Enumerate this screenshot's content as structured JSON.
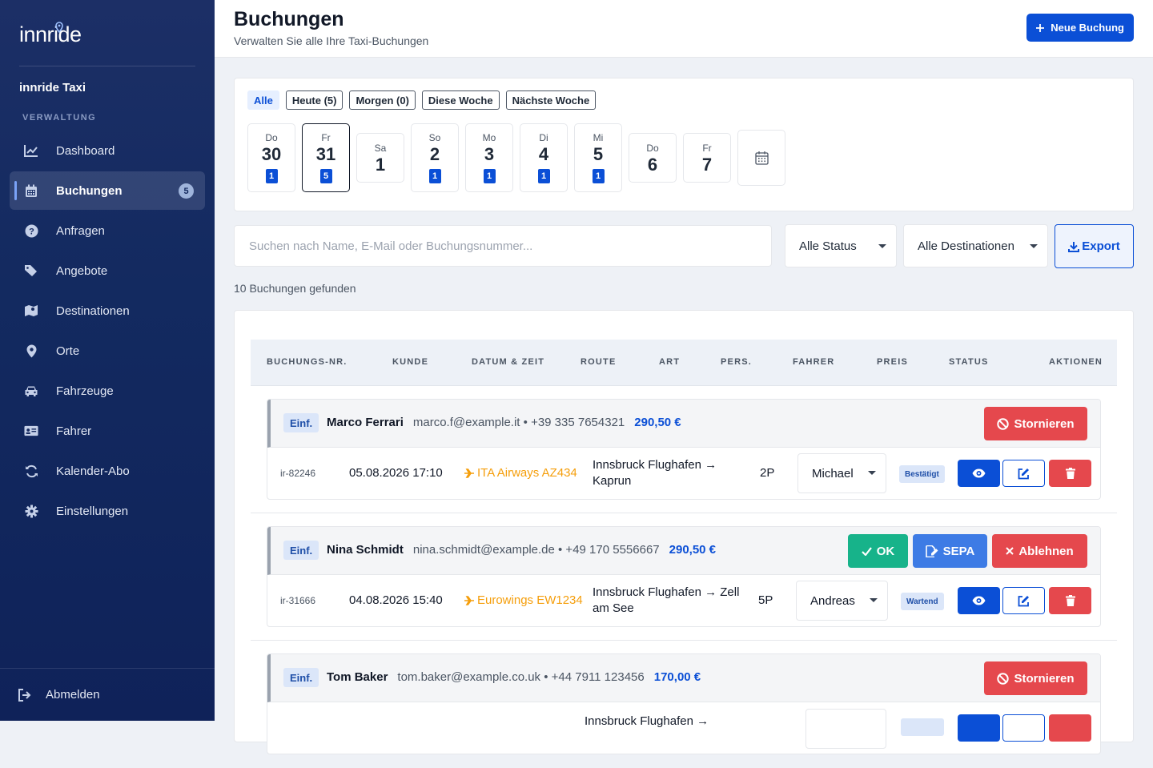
{
  "sidebar": {
    "logo": "innride",
    "brand": "innride Taxi",
    "section": "VERWALTUNG",
    "items": [
      {
        "label": "Dashboard",
        "icon": "chart-line-icon"
      },
      {
        "label": "Buchungen",
        "icon": "calendar-icon",
        "badge": "5",
        "active": true
      },
      {
        "label": "Anfragen",
        "icon": "question-circle-icon"
      },
      {
        "label": "Angebote",
        "icon": "tags-icon"
      },
      {
        "label": "Destinationen",
        "icon": "map-icon"
      },
      {
        "label": "Orte",
        "icon": "map-pin-icon"
      },
      {
        "label": "Fahrzeuge",
        "icon": "car-icon"
      },
      {
        "label": "Fahrer",
        "icon": "id-card-icon"
      },
      {
        "label": "Kalender-Abo",
        "icon": "sync-icon"
      },
      {
        "label": "Einstellungen",
        "icon": "gear-icon"
      }
    ],
    "logout": "Abmelden"
  },
  "header": {
    "title": "Buchungen",
    "subtitle": "Verwalten Sie alle Ihre Taxi-Buchungen",
    "new_button": "Neue Buchung"
  },
  "filters": {
    "chips": [
      "Alle",
      "Heute (5)",
      "Morgen (0)",
      "Diese Woche",
      "Nächste Woche"
    ],
    "days": [
      {
        "name": "Do",
        "num": "30",
        "badge": "1"
      },
      {
        "name": "Fr",
        "num": "31",
        "badge": "5",
        "selected": true
      },
      {
        "name": "Sa",
        "num": "1"
      },
      {
        "name": "So",
        "num": "2",
        "badge": "1"
      },
      {
        "name": "Mo",
        "num": "3",
        "badge": "1"
      },
      {
        "name": "Di",
        "num": "4",
        "badge": "1"
      },
      {
        "name": "Mi",
        "num": "5",
        "badge": "1"
      },
      {
        "name": "Do",
        "num": "6"
      },
      {
        "name": "Fr",
        "num": "7"
      }
    ]
  },
  "search": {
    "placeholder": "Suchen nach Name, E-Mail oder Buchungsnummer..."
  },
  "status_select": "Alle Status",
  "destination_select": "Alle Destinationen",
  "export_label": "Export",
  "results_count": "10 Buchungen gefunden",
  "columns": [
    "BUCHUNGS-NR.",
    "KUNDE",
    "DATUM & ZEIT",
    "ROUTE",
    "ART",
    "PERS.",
    "FAHRER",
    "PREIS",
    "STATUS",
    "AKTIONEN"
  ],
  "bookings": [
    {
      "type": "Einf.",
      "name": "Marco Ferrari",
      "contact": "marco.f@example.it • +39 335 7654321",
      "price": "290,50 €",
      "actions": [
        "Stornieren"
      ],
      "id": "ir-82246",
      "date": "05.08.2026 17:10",
      "flight": "ITA Airways AZ434",
      "route": "Innsbruck Flughafen → Kaprun",
      "persons": "2P",
      "driver": "Michael",
      "status": "Bestätigt"
    },
    {
      "type": "Einf.",
      "name": "Nina Schmidt",
      "contact": "nina.schmidt@example.de • +49 170 5556667",
      "price": "290,50 €",
      "actions": [
        "OK",
        "SEPA",
        "Ablehnen"
      ],
      "id": "ir-31666",
      "date": "04.08.2026 15:40",
      "flight": "Eurowings EW1234",
      "route": "Innsbruck Flughafen → Zell am See",
      "persons": "5P",
      "driver": "Andreas",
      "status": "Wartend"
    },
    {
      "type": "Einf.",
      "name": "Tom Baker",
      "contact": "tom.baker@example.co.uk • +44 7911 123456",
      "price": "170,00 €",
      "actions": [
        "Stornieren"
      ],
      "route": "Innsbruck Flughafen →"
    }
  ]
}
